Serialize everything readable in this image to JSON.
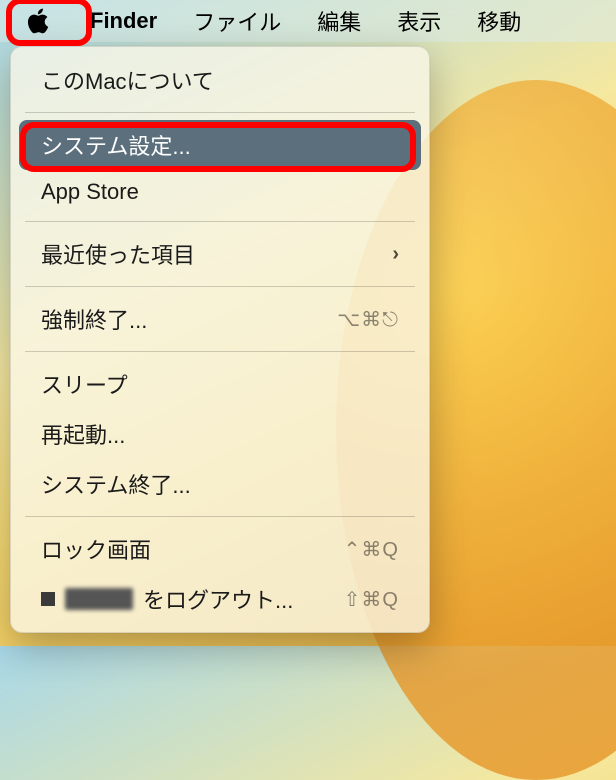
{
  "menubar": {
    "app_name": "Finder",
    "items": [
      "ファイル",
      "編集",
      "表示",
      "移動"
    ]
  },
  "appleMenu": {
    "about": "このMacについて",
    "systemSettings": "システム設定...",
    "appStore": "App Store",
    "recentItems": "最近使った項目",
    "forceQuit": "強制終了...",
    "forceQuitShortcut": "⌥⌘⎋",
    "sleep": "スリープ",
    "restart": "再起動...",
    "shutdown": "システム終了...",
    "lockScreen": "ロック画面",
    "lockScreenShortcut": "⌃⌘Q",
    "logoutSuffix": "をログアウト...",
    "logoutShortcut": "⇧⌘Q"
  },
  "highlights": {
    "apple_logo": true,
    "system_settings": true
  }
}
